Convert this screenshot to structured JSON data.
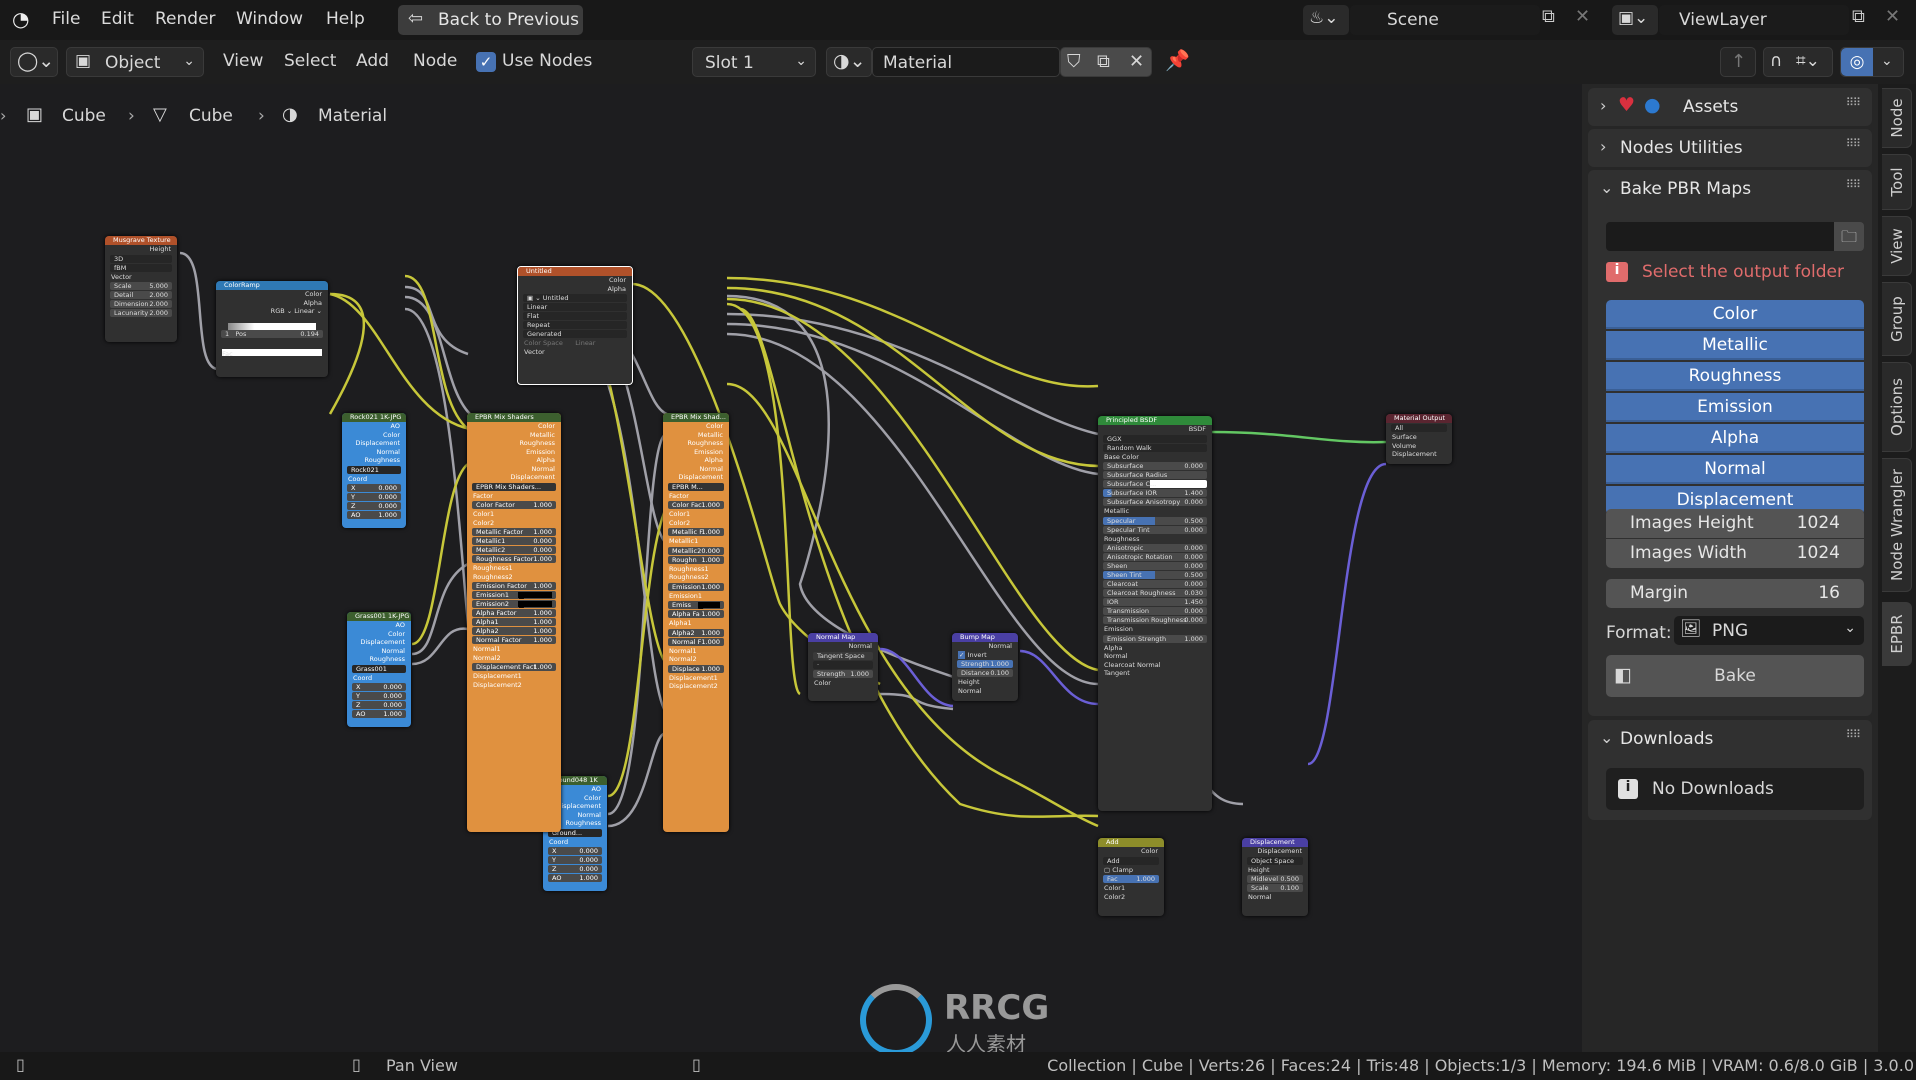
{
  "topbar": {
    "menus": [
      "File",
      "Edit",
      "Render",
      "Window",
      "Help"
    ],
    "back_button": "Back to Previous",
    "scene": "Scene",
    "view_layer": "ViewLayer"
  },
  "header": {
    "mode": "Object",
    "menus": [
      "View",
      "Select",
      "Add",
      "Node"
    ],
    "use_nodes_label": "Use Nodes",
    "use_nodes_checked": true,
    "slot": "Slot 1",
    "material": "Material"
  },
  "breadcrumb": [
    "Cube",
    "Cube",
    "Material"
  ],
  "nodes": {
    "musgrave": {
      "title": "Musgrave Texture",
      "out": "Height",
      "dim": "3D",
      "type": "fBM",
      "vector": "Vector",
      "fields": [
        [
          "Scale",
          "5.000"
        ],
        [
          "Detail",
          "2.000"
        ],
        [
          "Dimension",
          "2.000"
        ],
        [
          "Lacunarity",
          "2.000"
        ]
      ]
    },
    "colorramp": {
      "title": "ColorRamp",
      "outs": [
        "Color",
        "Alpha"
      ],
      "mode": "RGB",
      "interp": "Linear",
      "index": "1",
      "pos_label": "Pos",
      "pos": "0.194",
      "fac": "Fac"
    },
    "image": {
      "title": "Untitled",
      "outs": [
        "Color",
        "Alpha"
      ],
      "image_name": "Untitled",
      "opts": [
        "Linear",
        "Flat",
        "Repeat",
        "Generated"
      ],
      "colorspace_label": "Color Space",
      "colorspace": "Linear",
      "vector": "Vector"
    },
    "rock": {
      "title": "Rock021 1K-JPG",
      "outs": [
        "AO",
        "Color",
        "Displacement",
        "Normal",
        "Roughness"
      ],
      "group": "Rock021",
      "coord": "Coord",
      "fields": [
        [
          "X",
          "0.000"
        ],
        [
          "Y",
          "0.000"
        ],
        [
          "Z",
          "0.000"
        ],
        [
          "AO",
          "1.000"
        ]
      ]
    },
    "grass": {
      "title": "Grass001 1K-JPG",
      "outs": [
        "AO",
        "Color",
        "Displacement",
        "Normal",
        "Roughness"
      ],
      "group": "Grass001",
      "coord": "Coord",
      "fields": [
        [
          "X",
          "0.000"
        ],
        [
          "Y",
          "0.000"
        ],
        [
          "Z",
          "0.000"
        ],
        [
          "AO",
          "1.000"
        ]
      ]
    },
    "ground": {
      "title": "Ground048 1K",
      "outs": [
        "AO",
        "Color",
        "Displacement",
        "Normal",
        "Roughness"
      ],
      "group": "Ground...",
      "coord": "Coord",
      "fields": [
        [
          "X",
          "0.000"
        ],
        [
          "Y",
          "0.000"
        ],
        [
          "Z",
          "0.000"
        ],
        [
          "AO",
          "1.000"
        ]
      ]
    },
    "mix1": {
      "title": "EPBR Mix Shaders",
      "outs": [
        "Color",
        "Metallic",
        "Roughness",
        "Emission",
        "Alpha",
        "Normal",
        "Displacement"
      ],
      "group": "EPBR Mix Shaders...",
      "inputs": [
        [
          "Factor",
          ""
        ],
        [
          "Color Factor",
          "1.000"
        ],
        [
          "Color1",
          ""
        ],
        [
          "Color2",
          ""
        ],
        [
          "Metallic Factor",
          "1.000"
        ],
        [
          "Metallic1",
          "0.000"
        ],
        [
          "Metallic2",
          "0.000"
        ],
        [
          "Roughness Factor",
          "1.000"
        ],
        [
          "Roughness1",
          ""
        ],
        [
          "Roughness2",
          ""
        ],
        [
          "Emission Factor",
          "1.000"
        ],
        [
          "Emission1",
          "■"
        ],
        [
          "Emission2",
          "■"
        ],
        [
          "Alpha Factor",
          "1.000"
        ],
        [
          "Alpha1",
          "1.000"
        ],
        [
          "Alpha2",
          "1.000"
        ],
        [
          "Normal Factor",
          "1.000"
        ],
        [
          "Normal1",
          ""
        ],
        [
          "Normal2",
          ""
        ],
        [
          "Displacement Fact",
          "1.000"
        ],
        [
          "Displacement1",
          ""
        ],
        [
          "Displacement2",
          ""
        ]
      ]
    },
    "mix2": {
      "title": "EPBR Mix Shad...",
      "outs": [
        "Color",
        "Metallic",
        "Roughness",
        "Emission",
        "Alpha",
        "Normal",
        "Displacement"
      ],
      "group": "EPBR M...",
      "inputs": [
        [
          "Factor",
          ""
        ],
        [
          "Color Fac",
          "1.000"
        ],
        [
          "Color1",
          ""
        ],
        [
          "Color2",
          ""
        ],
        [
          "Metallic F",
          "1.000"
        ],
        [
          "Metallic1",
          ""
        ],
        [
          "Metallic2",
          "0.000"
        ],
        [
          "Roughn",
          "1.000"
        ],
        [
          "Roughness1",
          ""
        ],
        [
          "Roughness2",
          ""
        ],
        [
          "Emission",
          "1.000"
        ],
        [
          "Emission1",
          ""
        ],
        [
          "Emiss",
          "■"
        ],
        [
          "Alpha Fa",
          "1.000"
        ],
        [
          "Alpha1",
          ""
        ],
        [
          "Alpha2",
          "1.000"
        ],
        [
          "Normal F",
          "1.000"
        ],
        [
          "Normal1",
          ""
        ],
        [
          "Normal2",
          ""
        ],
        [
          "Displace",
          "1.000"
        ],
        [
          "Displacement1",
          ""
        ],
        [
          "Displacement2",
          ""
        ]
      ]
    },
    "normalmap": {
      "title": "Normal Map",
      "out": "Normal",
      "space": "Tangent Space",
      "strength_label": "Strength",
      "strength": "1.000",
      "color": "Color"
    },
    "bump": {
      "title": "Bump Map",
      "out": "Normal",
      "invert": "Invert",
      "fields": [
        [
          "Strength",
          "1.000"
        ],
        [
          "Distance",
          "0.100"
        ]
      ],
      "inputs": [
        "Height",
        "Normal"
      ]
    },
    "bsdf": {
      "title": "Principled BSDF",
      "out": "BSDF",
      "dist": "GGX",
      "sss": "Random Walk",
      "rows": [
        [
          "Base Color",
          ""
        ],
        [
          "Subsurface",
          "0.000"
        ],
        [
          "Subsurface Radius",
          ""
        ],
        [
          "Subsurface C...",
          ""
        ],
        [
          "Subsurface IOR",
          "1.400"
        ],
        [
          "Subsurface Anisotropy",
          "0.000"
        ],
        [
          "Metallic",
          ""
        ],
        [
          "Specular",
          "0.500"
        ],
        [
          "Specular Tint",
          "0.000"
        ],
        [
          "Roughness",
          ""
        ],
        [
          "Anisotropic",
          "0.000"
        ],
        [
          "Anisotropic Rotation",
          "0.000"
        ],
        [
          "Sheen",
          "0.000"
        ],
        [
          "Sheen Tint",
          "0.500"
        ],
        [
          "Clearcoat",
          "0.000"
        ],
        [
          "Clearcoat Roughness",
          "0.030"
        ],
        [
          "IOR",
          "1.450"
        ],
        [
          "Transmission",
          "0.000"
        ],
        [
          "Transmission Roughness",
          "0.000"
        ],
        [
          "Emission",
          ""
        ],
        [
          "Emission Strength",
          "1.000"
        ],
        [
          "Alpha",
          ""
        ],
        [
          "Normal",
          ""
        ],
        [
          "Clearcoat Normal",
          ""
        ],
        [
          "Tangent",
          ""
        ]
      ]
    },
    "add": {
      "title": "Add",
      "out": "Color",
      "op": "Add",
      "clamp": "Clamp",
      "fac_label": "Fac",
      "fac": "1.000",
      "inputs": [
        "Color1",
        "Color2"
      ]
    },
    "displacement": {
      "title": "Displacement",
      "out": "Displacement",
      "space": "Object Space",
      "height": "Height",
      "fields": [
        [
          "Midlevel",
          "0.500"
        ],
        [
          "Scale",
          "0.100"
        ]
      ],
      "normal": "Normal"
    },
    "output": {
      "title": "Material Output",
      "target": "All",
      "inputs": [
        "Surface",
        "Volume",
        "Displacement"
      ]
    }
  },
  "sidebar": {
    "panels": {
      "assets": "Assets",
      "node_utilities": "Nodes Utilities",
      "bake": "Bake PBR Maps",
      "downloads": "Downloads"
    },
    "output_folder_value": "",
    "warning": "Select the output folder",
    "map_buttons": [
      "Color",
      "Metallic",
      "Roughness",
      "Emission",
      "Alpha",
      "Normal",
      "Displacement"
    ],
    "images_height_label": "Images Height",
    "images_height": "1024",
    "images_width_label": "Images Width",
    "images_width": "1024",
    "margin_label": "Margin",
    "margin": "16",
    "format_label": "Format:",
    "format": "PNG",
    "bake_button": "Bake",
    "no_downloads": "No Downloads",
    "tabs": [
      "Node",
      "Tool",
      "View",
      "Group",
      "Options",
      "Node Wrangler",
      "EPBR"
    ],
    "active_tab": "EPBR"
  },
  "status": {
    "pan_view": "Pan View",
    "stats": "Collection | Cube | Verts:26 | Faces:24 | Tris:48 | Objects:1/3 | Memory: 194.6 MiB | VRAM: 0.6/8.0 GiB | 3.0.0"
  },
  "watermark": {
    "brand": "RRCG",
    "sub": "人人素材"
  },
  "colors": {
    "accent": "#4772b3",
    "warning": "#e06c6c",
    "orange_node": "#e0913f",
    "blue_node": "#3b8ad6",
    "wire_yellow": "#c7c73a",
    "wire_grey": "#a0a0a8",
    "wire_purple": "#6b5fd6",
    "wire_green": "#63c763"
  }
}
